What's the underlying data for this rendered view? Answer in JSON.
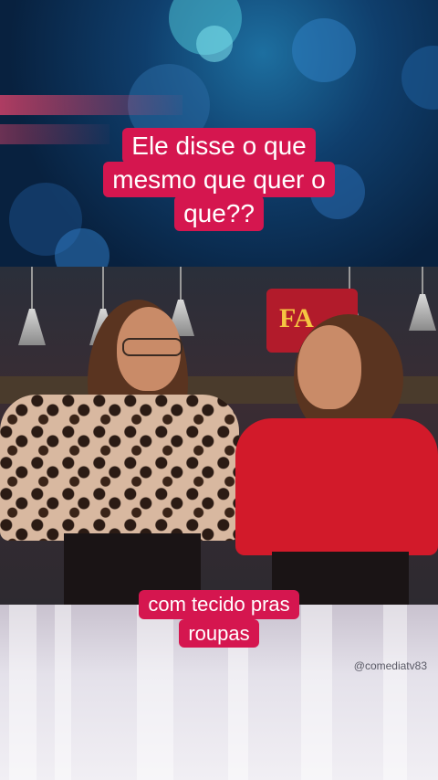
{
  "captions": {
    "top": [
      "Ele disse o que",
      "mesmo que quer o",
      "que??"
    ],
    "bottom": [
      "com tecido pras",
      "roupas"
    ]
  },
  "watermark": "@comediatv83",
  "colors": {
    "caption_bg": "#d5164f",
    "caption_text": "#ffffff",
    "top_background": "#0f3e6c",
    "bottom_background": "#e4e1ea"
  },
  "scene": {
    "sign_text": "FA"
  }
}
